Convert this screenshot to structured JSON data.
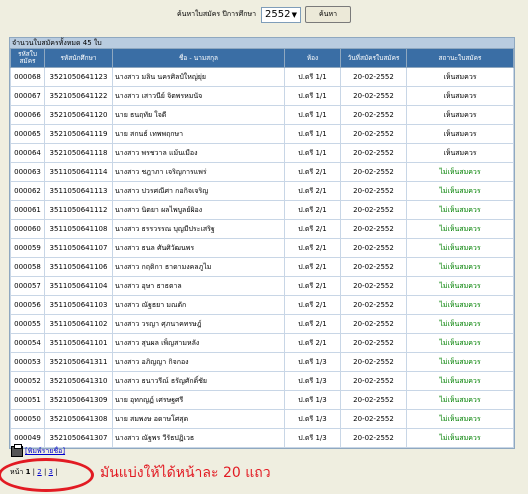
{
  "search": {
    "label": "ค้นหาใบสมัคร ปีการศึกษา",
    "year": "2552",
    "button": "ค้นหา"
  },
  "table": {
    "caption": "จำนวนใบสมัครทั้งหมด 45 ใบ",
    "headers": [
      "รหัสใบสมัคร",
      "รหัสนักศึกษา",
      "ชื่อ - นามสกุล",
      "ห้อง",
      "วันที่สมัครใบสมัคร",
      "สถานะใบสมัคร"
    ],
    "rows": [
      {
        "app": "000068",
        "sid": "3521050641123",
        "name": "นางสาว มลิน  นครศิลป์ใหญ่ยุ่ย",
        "room": "ป.ตรี 1/1",
        "date": "20-02-2552",
        "status": "เห็นสมควร",
        "ok": true
      },
      {
        "app": "000067",
        "sid": "3521050641122",
        "name": "นางสาว เสาวนีย์  จิตพรหมนัจ",
        "room": "ป.ตรี 1/1",
        "date": "20-02-2552",
        "status": "เห็นสมควร",
        "ok": true
      },
      {
        "app": "000066",
        "sid": "3521050641120",
        "name": "นาย ธนฤทัย  ใจดี",
        "room": "ป.ตรี 1/1",
        "date": "20-02-2552",
        "status": "เห็นสมควร",
        "ok": true
      },
      {
        "app": "000065",
        "sid": "3521050641119",
        "name": "นาย สกนธ์  เทพพฤกษา",
        "room": "ป.ตรี 1/1",
        "date": "20-02-2552",
        "status": "เห็นสมควร",
        "ok": true
      },
      {
        "app": "000064",
        "sid": "3521050641118",
        "name": "นางสาว พรชวาล  แม้นเมือง",
        "room": "ป.ตรี 1/1",
        "date": "20-02-2552",
        "status": "เห็นสมควร",
        "ok": true
      },
      {
        "app": "000063",
        "sid": "3511050641114",
        "name": "นางสาว ชฎาภา  เจริญการแพร่",
        "room": "ป.ตรี 2/1",
        "date": "20-02-2552",
        "status": "ไม่เห็นสมควร",
        "ok": false
      },
      {
        "app": "000062",
        "sid": "3511050641113",
        "name": "นางสาว ปวรศณีศา  กอกิจเจริญ",
        "room": "ป.ตรี 2/1",
        "date": "20-02-2552",
        "status": "ไม่เห็นสมควร",
        "ok": false
      },
      {
        "app": "000061",
        "sid": "3511050641112",
        "name": "นางสาว นิตยา  ผลไพบูลย์ผิอง",
        "room": "ป.ตรี 2/1",
        "date": "20-02-2552",
        "status": "ไม่เห็นสมควร",
        "ok": false
      },
      {
        "app": "000060",
        "sid": "3511050641108",
        "name": "นางสาว ธรรวรรณ  บุญมีประเสริฐ",
        "room": "ป.ตรี 2/1",
        "date": "20-02-2552",
        "status": "ไม่เห็นสมควร",
        "ok": false
      },
      {
        "app": "000059",
        "sid": "3511050641107",
        "name": "นางสาว ธนล  ศันศิวัฒนพร",
        "room": "ป.ตรี 2/1",
        "date": "20-02-2552",
        "status": "ไม่เห็นสมควร",
        "ok": false
      },
      {
        "app": "000058",
        "sid": "3511050641106",
        "name": "นางสาว กฤติกา  ธาดามงคลภูไม",
        "room": "ป.ตรี 2/1",
        "date": "20-02-2552",
        "status": "ไม่เห็นสมควร",
        "ok": false
      },
      {
        "app": "000057",
        "sid": "3511050641104",
        "name": "นางสาว อุษา  ธาธตาล",
        "room": "ป.ตรี 2/1",
        "date": "20-02-2552",
        "status": "ไม่เห็นสมควร",
        "ok": false
      },
      {
        "app": "000056",
        "sid": "3511050641103",
        "name": "นางสาว ณัฐธยา  มณตัก",
        "room": "ป.ตรี 2/1",
        "date": "20-02-2552",
        "status": "ไม่เห็นสมควร",
        "ok": false
      },
      {
        "app": "000055",
        "sid": "3511050641102",
        "name": "นางสาว วรญา  ศุภนาคทรษฎ์",
        "room": "ป.ตรี 2/1",
        "date": "20-02-2552",
        "status": "ไม่เห็นสมควร",
        "ok": false
      },
      {
        "app": "000054",
        "sid": "3511050641101",
        "name": "นางสาว สุนผล  เพ็ญสามหลัง",
        "room": "ป.ตรี 2/1",
        "date": "20-02-2552",
        "status": "ไม่เห็นสมควร",
        "ok": false
      },
      {
        "app": "000053",
        "sid": "3521050641311",
        "name": "นางสาว อภิญญา  กิจกอง",
        "room": "ป.ตรี 1/3",
        "date": "20-02-2552",
        "status": "ไม่เห็นสมควร",
        "ok": false
      },
      {
        "app": "000052",
        "sid": "3521050641310",
        "name": "นางสาว ธนาวรีณ์  ธรัญศักดิ์ชัย",
        "room": "ป.ตรี 1/3",
        "date": "20-02-2552",
        "status": "ไม่เห็นสมควร",
        "ok": false
      },
      {
        "app": "000051",
        "sid": "3521050641309",
        "name": "นาย อุทกญฏ์  เศรษฐศรี",
        "room": "ป.ตรี 1/3",
        "date": "20-02-2552",
        "status": "ไม่เห็นสมควร",
        "ok": false
      },
      {
        "app": "000050",
        "sid": "3521050641308",
        "name": "นาย สมพงษ  อดาษโศสุด",
        "room": "ป.ตรี 1/3",
        "date": "20-02-2552",
        "status": "ไม่เห็นสมควร",
        "ok": false
      },
      {
        "app": "000049",
        "sid": "3521050641307",
        "name": "นางสาว ณัฐพร  วีรัธปฏิเวธ",
        "room": "ป.ตรี 1/3",
        "date": "20-02-2552",
        "status": "ไม่เห็นสมควร",
        "ok": false
      }
    ]
  },
  "print_label": "[พิมพ์รายชื่อ]",
  "pager": {
    "prefix": "หน้า",
    "current": "1",
    "pages": [
      "2",
      "3"
    ]
  },
  "annotation": "มันแบ่งให้ได้หน้าละ 20 แถว",
  "colors": {
    "header": "#3a6ea5",
    "caption": "#b9cce0",
    "ok": "#000000",
    "no": "#008000",
    "annotation": "#e21b23"
  }
}
